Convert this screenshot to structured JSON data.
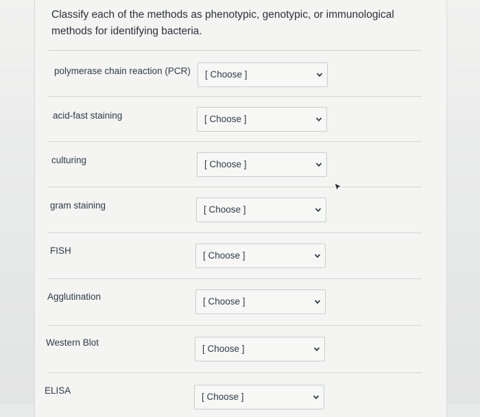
{
  "question": {
    "text": "Classify each of the methods as phenotypic, genotypic, or immunological methods for identifying bacteria."
  },
  "rows": [
    {
      "label": "polymerase chain reaction (PCR)",
      "selected": "[ Choose ]"
    },
    {
      "label": "acid-fast staining",
      "selected": "[ Choose ]"
    },
    {
      "label": "culturing",
      "selected": "[ Choose ]"
    },
    {
      "label": "gram staining",
      "selected": "[ Choose ]"
    },
    {
      "label": "FISH",
      "selected": "[ Choose ]"
    },
    {
      "label": "Agglutination",
      "selected": "[ Choose ]"
    },
    {
      "label": "Western Blot",
      "selected": "[ Choose ]"
    },
    {
      "label": "ELISA",
      "selected": "[ Choose ]"
    }
  ],
  "icons": {
    "dropdown": "chevron-down-icon",
    "cursor": "cursor-arrow-icon"
  },
  "colors": {
    "text": "#2d3b45",
    "background": "#f4f4f3",
    "select_border": "#c8cbce"
  }
}
